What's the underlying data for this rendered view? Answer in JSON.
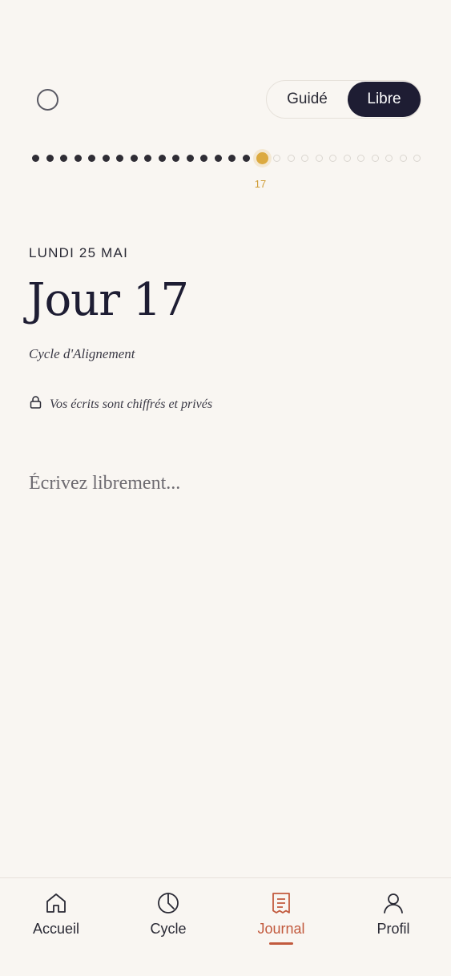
{
  "header": {
    "mode_toggle": {
      "options": [
        "Guidé",
        "Libre"
      ],
      "selected": "Libre"
    }
  },
  "day_track": {
    "total_days": 28,
    "current_day": 17,
    "current_marker": "17"
  },
  "entry": {
    "date_label": "LUNDI 25 MAI",
    "title": "Jour 17",
    "cycle_name": "Cycle d'Alignement",
    "privacy_note": "Vos écrits sont chiffrés et privés",
    "privacy_icon": "lock-icon",
    "placeholder": "Écrivez librement..."
  },
  "tab_bar": {
    "items": [
      {
        "label": "Accueil",
        "icon": "home-icon"
      },
      {
        "label": "Cycle",
        "icon": "cycle-clock-icon"
      },
      {
        "label": "Journal",
        "icon": "journal-icon",
        "active": true
      },
      {
        "label": "Profil",
        "icon": "profile-icon"
      }
    ]
  },
  "colors": {
    "background": "#f9f6f2",
    "ink": "#1e1d33",
    "accent_gold": "#dcaa40",
    "accent_active": "#c25a3e"
  }
}
